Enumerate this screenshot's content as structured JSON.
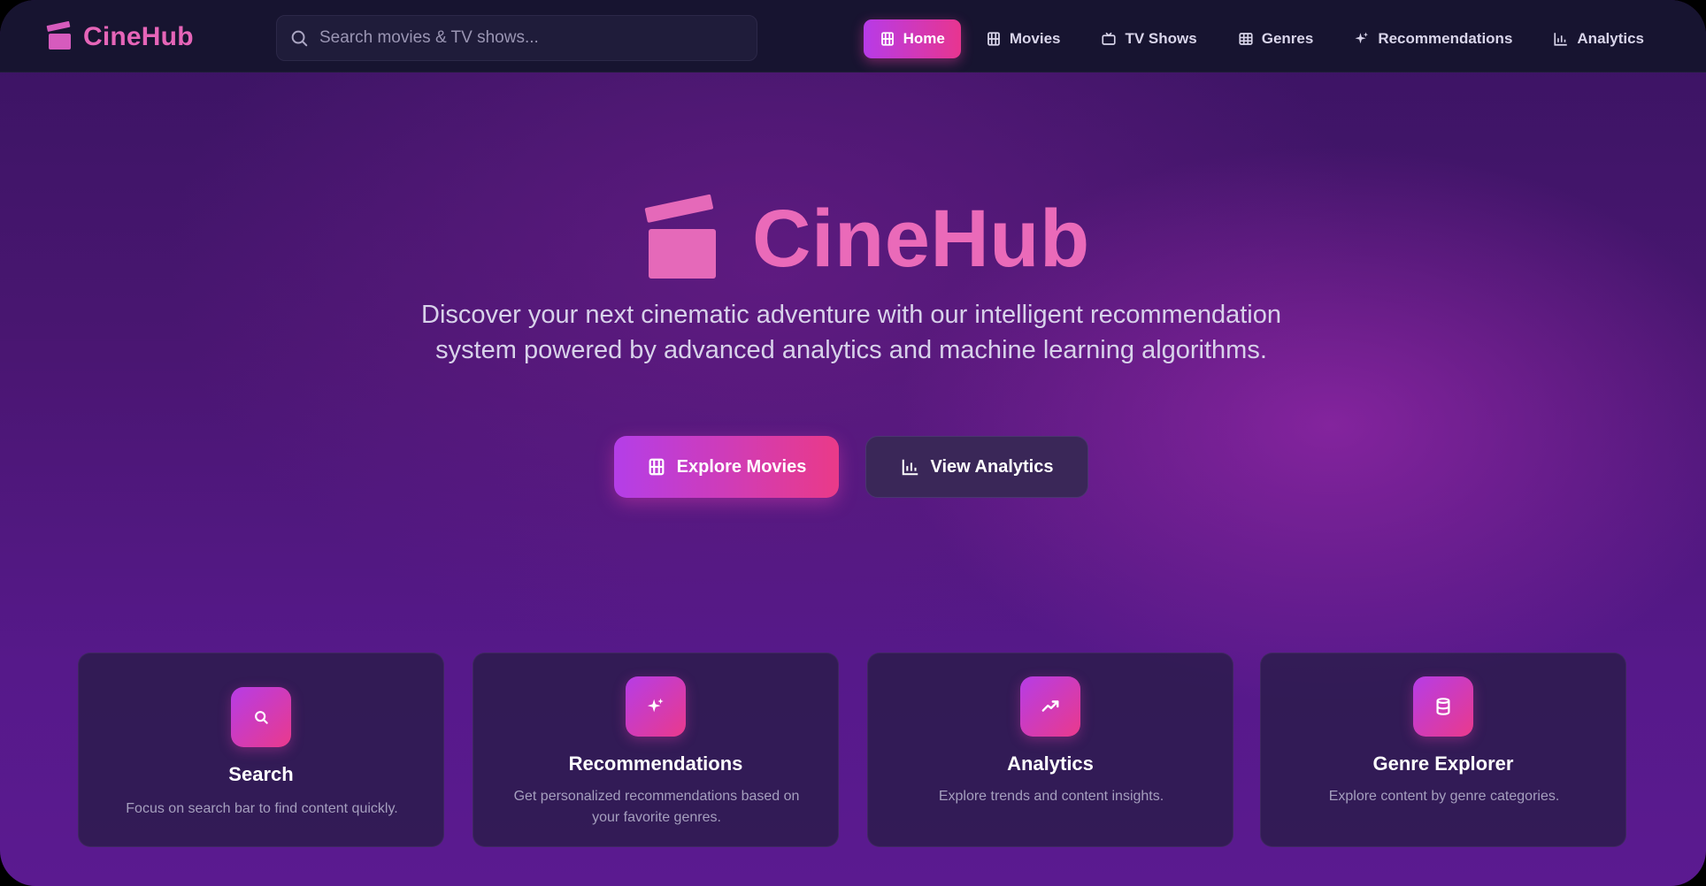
{
  "app": {
    "brand": "CineHub"
  },
  "search": {
    "placeholder": "Search movies & TV shows..."
  },
  "nav": {
    "items": [
      {
        "label": "Home",
        "icon": "film-icon",
        "active": true
      },
      {
        "label": "Movies",
        "icon": "film-icon",
        "active": false
      },
      {
        "label": "TV Shows",
        "icon": "tv-icon",
        "active": false
      },
      {
        "label": "Genres",
        "icon": "grid-icon",
        "active": false
      },
      {
        "label": "Recommendations",
        "icon": "sparkles-icon",
        "active": false
      },
      {
        "label": "Analytics",
        "icon": "bar-chart-icon",
        "active": false
      }
    ]
  },
  "hero": {
    "title": "CineHub",
    "description": "Discover your next cinematic adventure with our intelligent recommendation system powered by advanced analytics and machine learning algorithms.",
    "primary_button": "Explore Movies",
    "secondary_button": "View Analytics"
  },
  "features": [
    {
      "title": "Search",
      "description": "Focus on search bar to find content quickly.",
      "icon": "search-icon"
    },
    {
      "title": "Recommendations",
      "description": "Get personalized recommendations based on your favorite genres.",
      "icon": "sparkles-icon"
    },
    {
      "title": "Analytics",
      "description": "Explore trends and content insights.",
      "icon": "trend-icon"
    },
    {
      "title": "Genre Explorer",
      "description": "Explore content by genre categories.",
      "icon": "database-icon"
    }
  ],
  "colors": {
    "accent_start": "#b73be8",
    "accent_end": "#e8358f",
    "brand_pink": "#e665b8",
    "nav_bg": "#171430"
  }
}
